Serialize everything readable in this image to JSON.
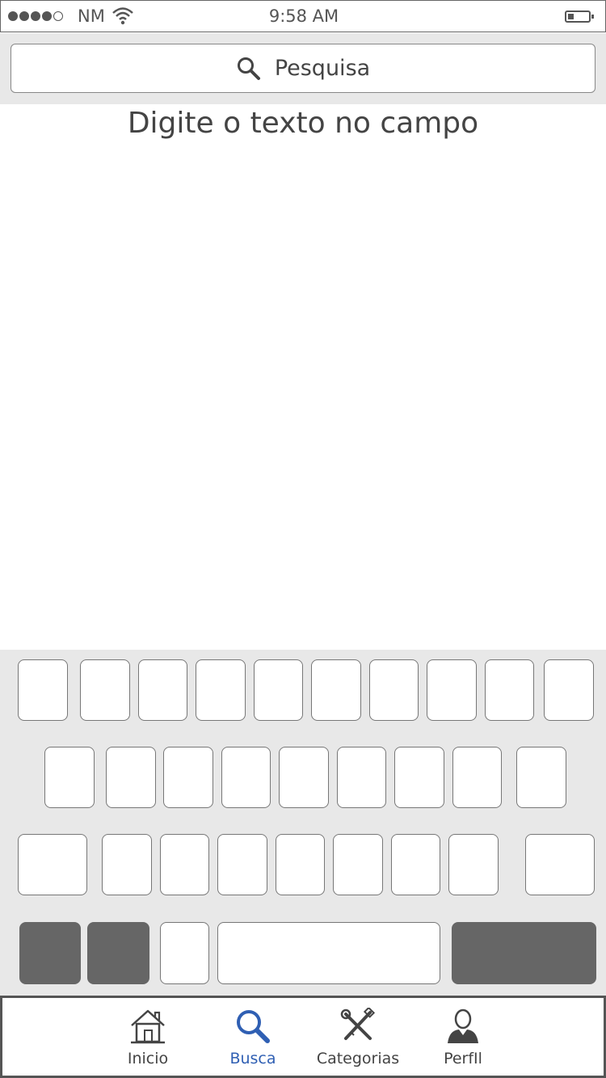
{
  "status_bar": {
    "carrier": "NM",
    "time": "9:58 AM",
    "signal_bars_filled": 4,
    "signal_bars_total": 5,
    "battery_level": 0.3
  },
  "search": {
    "placeholder": "Pesquisa",
    "icon": "search-icon"
  },
  "main": {
    "instruction": "Digite o texto no campo"
  },
  "keyboard": {
    "rows": [
      10,
      9,
      9,
      5
    ],
    "labels_visible": false
  },
  "tab_bar": {
    "items": [
      {
        "label": "Inicio",
        "icon": "home-icon",
        "active": false
      },
      {
        "label": "Busca",
        "icon": "search-icon",
        "active": true
      },
      {
        "label": "Categorias",
        "icon": "tools-icon",
        "active": false
      },
      {
        "label": "PerfIl",
        "icon": "person-icon",
        "active": false
      }
    ]
  },
  "colors": {
    "active_tab": "#2f5fb3",
    "panel_bg": "#e8e8e8",
    "dark_key": "#666666"
  }
}
